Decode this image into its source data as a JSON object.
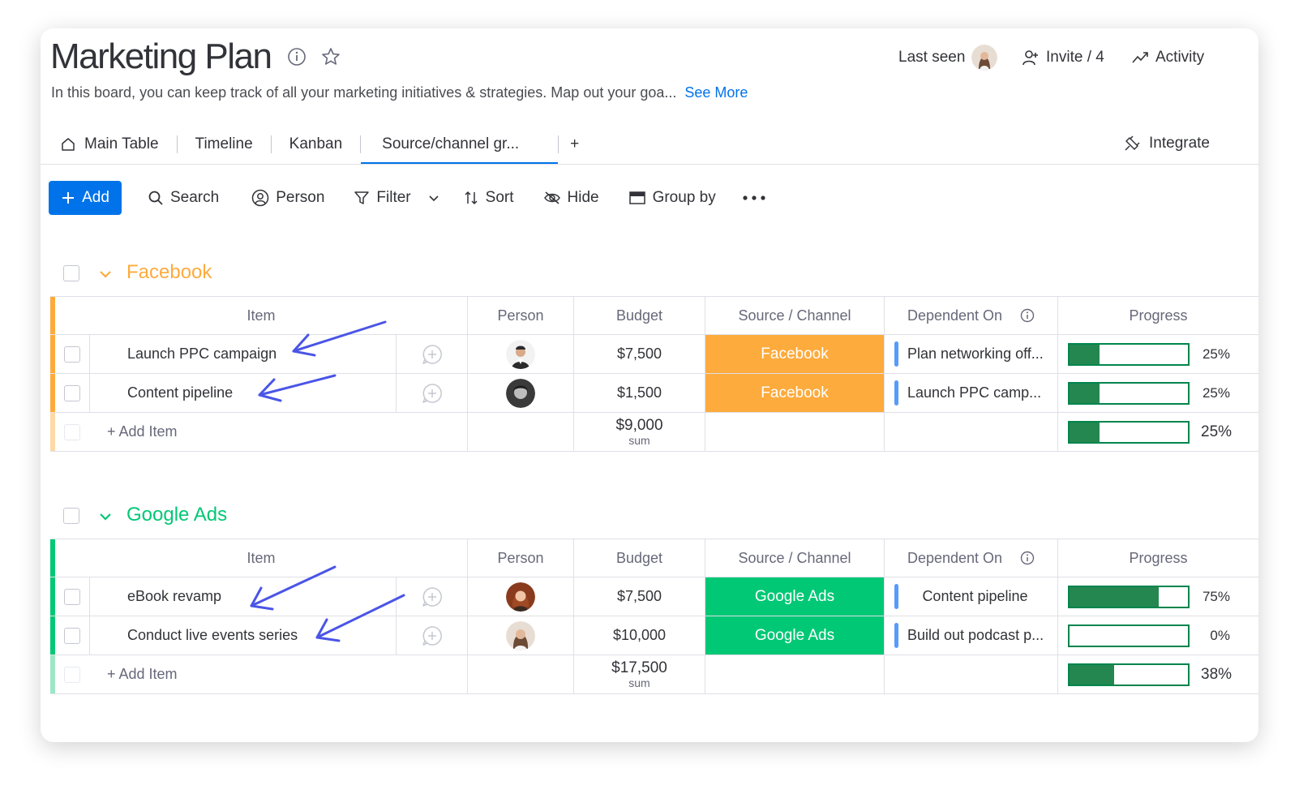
{
  "board": {
    "title": "Marketing Plan",
    "description": "In this board, you can keep track of all your marketing initiatives & strategies. Map out your goa...",
    "see_more": "See More"
  },
  "header": {
    "last_seen": "Last seen",
    "invite": "Invite / 4",
    "activity": "Activity",
    "integrate": "Integrate"
  },
  "tabs": [
    {
      "label": "Main Table",
      "icon": "home-icon"
    },
    {
      "label": "Timeline"
    },
    {
      "label": "Kanban"
    },
    {
      "label": "Source/channel gr...",
      "active": true
    },
    {
      "label": "+"
    }
  ],
  "toolbar": {
    "add": "Add",
    "search": "Search",
    "person": "Person",
    "filter": "Filter",
    "sort": "Sort",
    "hide": "Hide",
    "group_by": "Group by"
  },
  "columns": {
    "item": "Item",
    "person": "Person",
    "budget": "Budget",
    "channel": "Source / Channel",
    "dependent": "Dependent On",
    "progress": "Progress"
  },
  "colors": {
    "facebook": "#fdab3d",
    "google": "#00c875",
    "accent": "#0073ea",
    "progress": "#258750"
  },
  "groups": [
    {
      "name": "Facebook",
      "rows": [
        {
          "item": "Launch PPC campaign",
          "budget": "$7,500",
          "channel": "Facebook",
          "dependent": "Plan networking off...",
          "progress": 0.25,
          "progress_label": "25%"
        },
        {
          "item": "Content pipeline",
          "budget": "$1,500",
          "channel": "Facebook",
          "dependent": "Launch PPC camp...",
          "progress": 0.25,
          "progress_label": "25%"
        }
      ],
      "add_item": "+ Add Item",
      "sum_value": "$9,000",
      "sum_label": "sum",
      "sum_progress": 0.25,
      "sum_progress_label": "25%"
    },
    {
      "name": "Google Ads",
      "rows": [
        {
          "item": "eBook revamp",
          "budget": "$7,500",
          "channel": "Google Ads",
          "dependent": "Content pipeline",
          "progress": 0.75,
          "progress_label": "75%"
        },
        {
          "item": "Conduct live events series",
          "budget": "$10,000",
          "channel": "Google Ads",
          "dependent": "Build out podcast p...",
          "progress": 0,
          "progress_label": "0%"
        }
      ],
      "add_item": "+ Add Item",
      "sum_value": "$17,500",
      "sum_label": "sum",
      "sum_progress": 0.38,
      "sum_progress_label": "38%"
    }
  ]
}
